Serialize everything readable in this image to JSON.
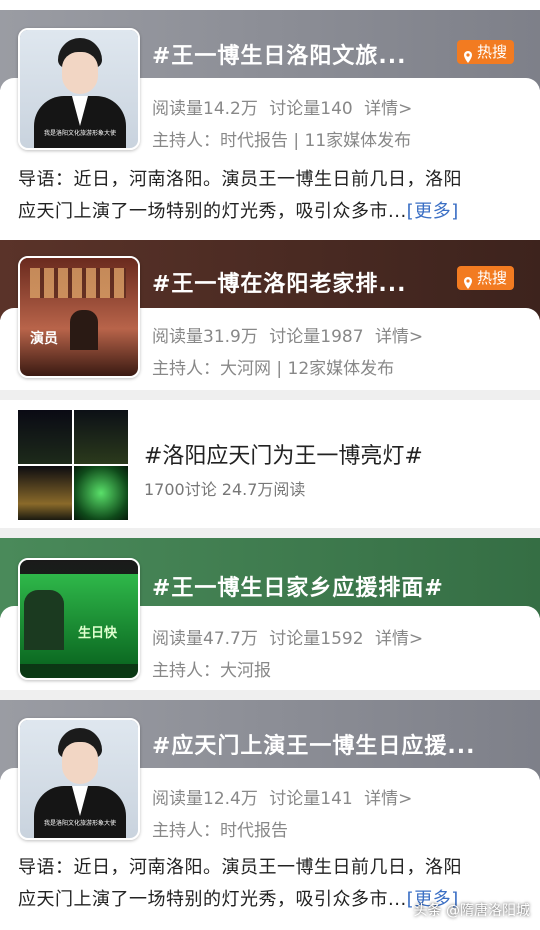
{
  "watermark": "头条 @隋唐洛阳城",
  "cards": [
    {
      "title": "#王一博生日洛阳文旅...",
      "badge": "热搜",
      "reads": "阅读量14.2万",
      "discuss": "讨论量140",
      "detail": "详情>",
      "host": "主持人：时代报告 | 11家媒体发布",
      "intro_line1": "导语：近日，河南洛阳。演员王一博生日前几日，洛阳",
      "intro_line2": "应天门上演了一场特别的灯光秀，吸引众多市...",
      "more": "[更多]",
      "thumb_caption": "我是洛阳文化旅游形象大使",
      "banner_color": "#8d8f96"
    },
    {
      "title": "#王一博在洛阳老家排...",
      "badge": "热搜",
      "reads": "阅读量31.9万",
      "discuss": "讨论量1987",
      "detail": "详情>",
      "host": "主持人：大河网 | 12家媒体发布",
      "thumb_caption": "演员",
      "banner_color": "#4a2a23"
    },
    {
      "title": "#洛阳应天门为王一博亮灯#",
      "meta": "1700讨论 24.7万阅读"
    },
    {
      "title": "#王一博生日家乡应援排面#",
      "reads": "阅读量47.7万",
      "discuss": "讨论量1592",
      "detail": "详情>",
      "host": "主持人：大河报",
      "thumb_caption": "生日快",
      "banner_color": "#3e7a4e"
    },
    {
      "title": "#应天门上演王一博生日应援...",
      "reads": "阅读量12.4万",
      "discuss": "讨论量141",
      "detail": "详情>",
      "host": "主持人：时代报告",
      "intro_line1": "导语：近日，河南洛阳。演员王一博生日前几日，洛阳",
      "intro_line2": "应天门上演了一场特别的灯光秀，吸引众多市...",
      "more": "[更多]",
      "thumb_caption": "我是洛阳文化旅游形象大使",
      "banner_color": "#8d8f96"
    }
  ]
}
